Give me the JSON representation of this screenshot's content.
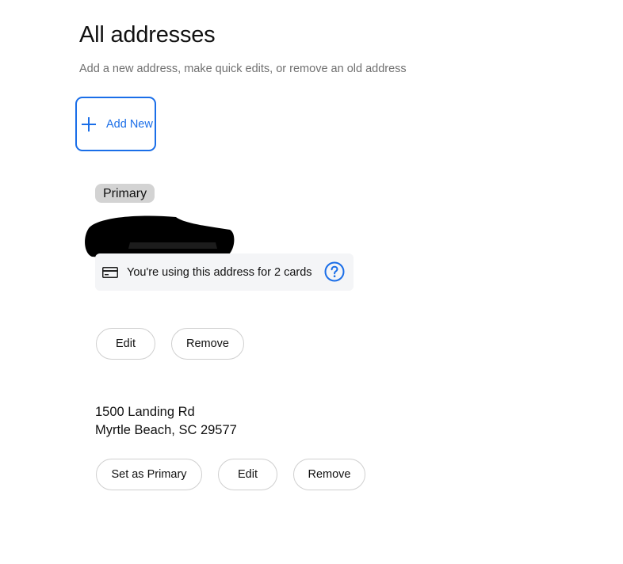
{
  "header": {
    "title": "All addresses",
    "subtitle": "Add a new address, make quick edits, or remove an old address"
  },
  "add_new": {
    "label": "Add New",
    "icon": "plus-icon"
  },
  "addresses": [
    {
      "badge": "Primary",
      "address_redacted": true,
      "notice": {
        "icon": "credit-card-icon",
        "text": "You're using this address for 2 cards",
        "help_icon": "question-circle-icon"
      },
      "actions": {
        "edit": "Edit",
        "remove": "Remove"
      }
    },
    {
      "line1": "1500 Landing Rd",
      "line2": "Myrtle Beach, SC 29577",
      "actions": {
        "set_primary": "Set as Primary",
        "edit": "Edit",
        "remove": "Remove"
      }
    }
  ],
  "colors": {
    "accent": "#1a6ee8",
    "badge_bg": "#d3d3d3",
    "notice_bg": "#f4f5f7",
    "subtitle_text": "#707070",
    "button_border": "#cfcfcf"
  }
}
